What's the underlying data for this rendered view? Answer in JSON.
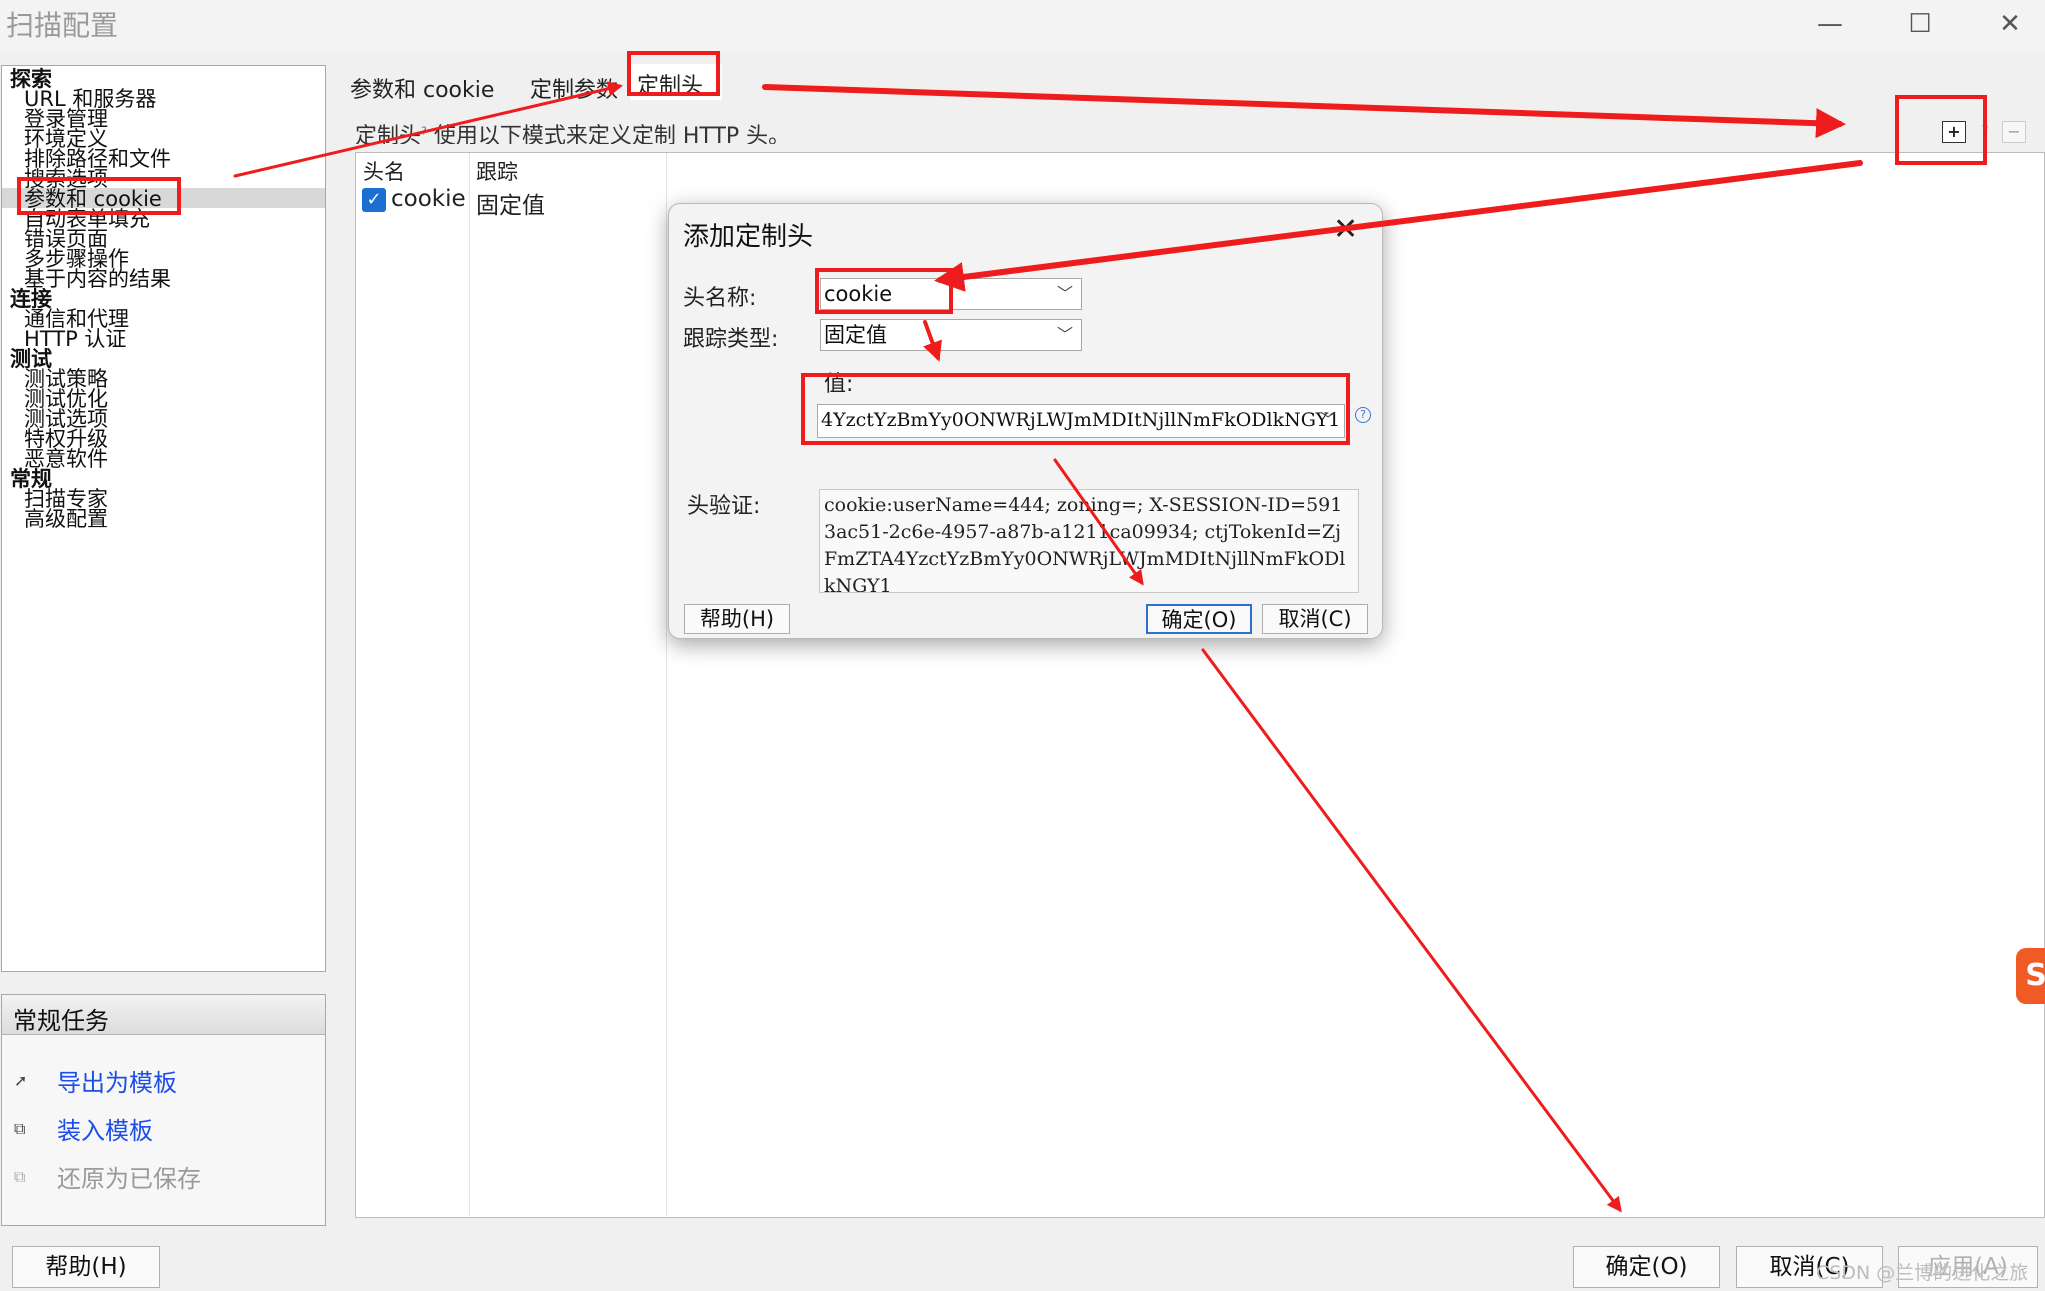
{
  "window": {
    "title": "扫描配置",
    "minimize_glyph": "—",
    "maximize_glyph": "☐",
    "close_glyph": "✕"
  },
  "nav": {
    "categories": [
      {
        "label": "探索",
        "items": [
          "URL 和服务器",
          "登录管理",
          "环境定义",
          "排除路径和文件",
          "搜索选项",
          "参数和 cookie",
          "自动表单填充",
          "错误页面",
          "多步骤操作",
          "基于内容的结果"
        ]
      },
      {
        "label": "连接",
        "items": [
          "通信和代理",
          "HTTP 认证"
        ]
      },
      {
        "label": "测试",
        "items": [
          "测试策略",
          "测试优化",
          "测试选项",
          "特权升级",
          "恶意软件"
        ]
      },
      {
        "label": "常规",
        "items": [
          "扫描专家",
          "高级配置"
        ]
      }
    ],
    "selected": "参数和 cookie"
  },
  "tasks": {
    "title": "常规任务",
    "items": [
      {
        "label": "导出为模板",
        "icon": "export-icon",
        "glyph": "➚"
      },
      {
        "label": "装入模板",
        "icon": "load-icon",
        "glyph": "⧉"
      },
      {
        "label": "还原为已保存",
        "icon": "revert-icon",
        "glyph": "⧉"
      }
    ]
  },
  "tabs": [
    {
      "label": "参数和 cookie"
    },
    {
      "label": "定制参数"
    },
    {
      "label": "定制头"
    }
  ],
  "active_tab": "定制头",
  "section": {
    "label": "定制头",
    "help_glyph": "?",
    "description": "使用以下模式来定义定制 HTTP 头。"
  },
  "toolbar": {
    "add_glyph": "+",
    "help_glyph": "?",
    "remove_glyph": "−"
  },
  "table": {
    "columns": [
      "头名",
      "跟踪"
    ],
    "rows": [
      {
        "checked": true,
        "check_glyph": "✓",
        "name": "cookie",
        "tracking": "固定值"
      }
    ]
  },
  "dialog": {
    "title": "添加定制头",
    "close_glyph": "✕",
    "name_label": "头名称:",
    "name_value": "cookie",
    "track_label": "跟踪类型:",
    "track_value": "固定值",
    "value_label": "值:",
    "value_value": "4YzctYzBmYy0ONWRjLWJmMDItNjllNmFkODlkNGY1",
    "value_help_glyph": "?",
    "verify_label": "头验证:",
    "verify_text": "cookie:userName=444; zoning=; X-SESSION-ID=5913ac51-2c6e-4957-a87b-a1211ca09934; ctjTokenId=ZjFmZTA4YzctYzBmYy0ONWRjLWJmMDItNjllNmFkODlkNGY1",
    "arrow_glyph": "﹀",
    "help_button": "帮助(H)",
    "ok_button": "确定(O)",
    "cancel_button": "取消(C)"
  },
  "bottom": {
    "help_button": "帮助(H)",
    "ok_button": "确定(O)",
    "cancel_button": "取消(C)",
    "apply_button": "应用(A)"
  },
  "watermark": "CSDN @兰博的进化之旅",
  "side_badge": "S",
  "colors": {
    "annotation_red": "#ee1c1c",
    "link_blue": "#1c4ee8",
    "checkbox_blue": "#1b6fd0",
    "badge_orange": "#f05a24"
  }
}
